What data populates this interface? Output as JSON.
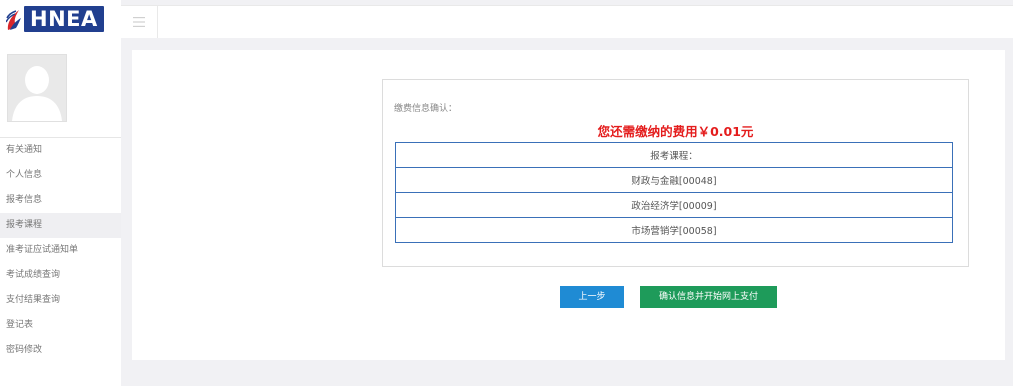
{
  "header": {
    "logo_text": "HNEA"
  },
  "sidebar": {
    "items": [
      {
        "label": "有关通知",
        "active": false
      },
      {
        "label": "个人信息",
        "active": false
      },
      {
        "label": "报考信息",
        "active": false
      },
      {
        "label": "报考课程",
        "active": true
      },
      {
        "label": "准考证应试通知单",
        "active": false
      },
      {
        "label": "考试成绩查询",
        "active": false
      },
      {
        "label": "支付结果查询",
        "active": false
      },
      {
        "label": "登记表",
        "active": false
      },
      {
        "label": "密码修改",
        "active": false
      }
    ]
  },
  "main": {
    "section_label": "缴费信息确认：",
    "fee_text": "您还需缴纳的费用￥0.01元",
    "table": {
      "header": "报考课程：",
      "rows": [
        "财政与金融[00048]",
        "政治经济学[00009]",
        "市场营销学[00058]"
      ]
    },
    "buttons": {
      "prev": "上一步",
      "pay": "确认信息并开始网上支付"
    }
  },
  "colors": {
    "fee": "#e41d1d",
    "table_border": "#3a70b8",
    "prev_button": "#1f8bd4",
    "pay_button": "#1e9b5a",
    "logo_bg": "#213f8f"
  }
}
